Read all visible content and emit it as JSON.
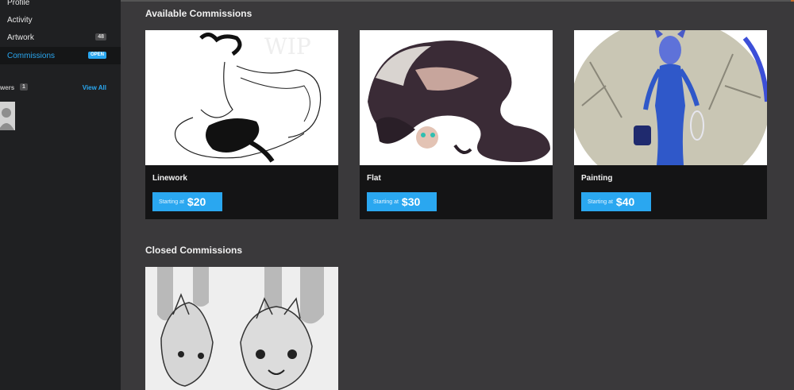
{
  "sidebar": {
    "items": [
      {
        "label": "Profile"
      },
      {
        "label": "Activity"
      },
      {
        "label": "Artwork",
        "count": "48"
      },
      {
        "label": "Commissions",
        "badge": "OPEN"
      }
    ],
    "watchers": {
      "label": "wers",
      "count": "1",
      "view_all": "View All"
    }
  },
  "available": {
    "title": "Available Commissions",
    "cards": [
      {
        "name": "Linework",
        "starting_label": "Starting at",
        "price": "$20"
      },
      {
        "name": "Flat",
        "starting_label": "Starting at",
        "price": "$30"
      },
      {
        "name": "Painting",
        "starting_label": "Starting at",
        "price": "$40"
      }
    ]
  },
  "closed": {
    "title": "Closed Commissions"
  },
  "colors": {
    "accent": "#2aa7f0",
    "background": "#3a393b",
    "sidebar": "#1f2022",
    "card": "#141415"
  }
}
